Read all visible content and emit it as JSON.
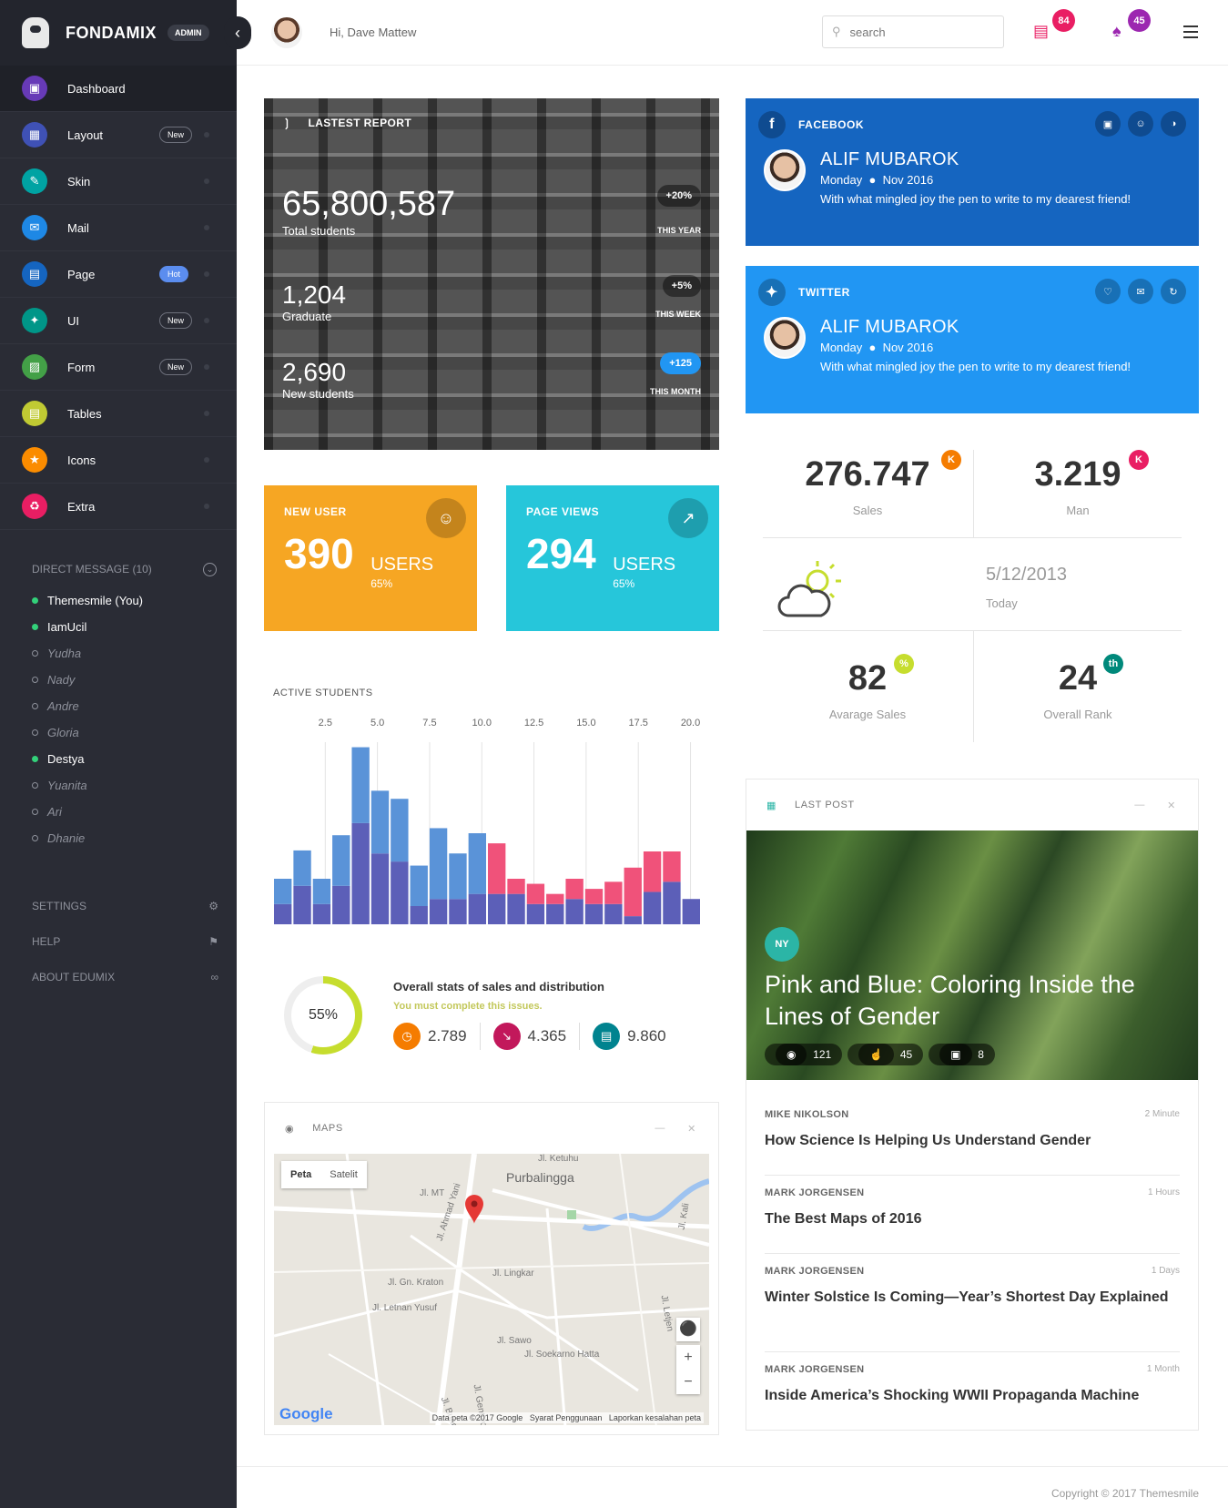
{
  "brand": {
    "name": "FONDAMIX",
    "badge": "ADMIN"
  },
  "sidebar": {
    "items": [
      {
        "label": "Dashboard",
        "color": "#673ab7",
        "active": true
      },
      {
        "label": "Layout",
        "color": "#3f51b5",
        "tag": "New"
      },
      {
        "label": "Skin",
        "color": "#00a3a3"
      },
      {
        "label": "Mail",
        "color": "#1e88e5"
      },
      {
        "label": "Page",
        "color": "#1565c0",
        "tag": "Hot"
      },
      {
        "label": "UI",
        "color": "#009688",
        "tag": "New"
      },
      {
        "label": "Form",
        "color": "#43a047",
        "tag": "New"
      },
      {
        "label": "Tables",
        "color": "#c0ca33"
      },
      {
        "label": "Icons",
        "color": "#fb8c00"
      },
      {
        "label": "Extra",
        "color": "#e91e63"
      }
    ],
    "dm_title": "DIRECT MESSAGE (10)",
    "dm": [
      {
        "name": "Themesmile (You)",
        "online": true
      },
      {
        "name": "IamUcil",
        "online": true
      },
      {
        "name": "Yudha",
        "online": false
      },
      {
        "name": "Nady",
        "online": false
      },
      {
        "name": "Andre",
        "online": false
      },
      {
        "name": "Gloria",
        "online": false
      },
      {
        "name": "Destya",
        "online": true
      },
      {
        "name": "Yuanita",
        "online": false
      },
      {
        "name": "Ari",
        "online": false
      },
      {
        "name": "Dhanie",
        "online": false
      }
    ],
    "settings": "SETTINGS",
    "help": "HELP",
    "about": "ABOUT EDUMIX"
  },
  "topbar": {
    "greeting": "Hi, Dave Mattew",
    "search_placeholder": "search",
    "docs_count": "84",
    "notif_count": "45"
  },
  "report": {
    "title": "LASTEST REPORT",
    "rows": [
      {
        "value": "65,800,587",
        "label": "Total students",
        "pill": "+20%",
        "period": "THIS YEAR"
      },
      {
        "value": "1,204",
        "label": "Graduate",
        "pill": "+5%",
        "period": "THIS WEEK"
      },
      {
        "value": "2,690",
        "label": "New students",
        "pill": "+125",
        "period": "THIS MONTH"
      }
    ]
  },
  "new_user": {
    "title": "NEW USER",
    "value": "390",
    "unit": "USERS",
    "pct": "65%",
    "color": "#f6a623"
  },
  "page_views": {
    "title": "PAGE VIEWS",
    "value": "294",
    "unit": "USERS",
    "pct": "65%",
    "color": "#26c6da"
  },
  "chart_data": {
    "type": "bar",
    "title": "ACTIVE STUDENTS",
    "x_ticks": [
      "2.5",
      "5.0",
      "7.5",
      "10.0",
      "12.5",
      "15.0",
      "17.5",
      "20.0"
    ],
    "xlim": [
      0,
      20.5
    ],
    "ylim": [
      0,
      180
    ],
    "colors": {
      "base": "#5c5fb8",
      "blue": "#5a93d8",
      "pink": "#f0527a"
    },
    "series": [
      {
        "values": [
          20,
          38,
          20,
          38,
          100,
          70,
          62,
          18,
          25,
          25,
          30,
          30,
          30,
          20,
          20,
          25,
          20,
          20,
          8,
          32,
          42,
          25
        ]
      },
      {
        "values": [
          25,
          35,
          25,
          50,
          75,
          62,
          62,
          40,
          70,
          45,
          60,
          0,
          0,
          0,
          0,
          0,
          0,
          0,
          0,
          0,
          0,
          0
        ],
        "color": "blue"
      },
      {
        "values": [
          0,
          0,
          0,
          0,
          0,
          0,
          0,
          0,
          0,
          0,
          0,
          50,
          15,
          20,
          10,
          20,
          15,
          22,
          48,
          40,
          30
        ],
        "color": "pink"
      }
    ]
  },
  "overall": {
    "donut": "55%",
    "donut_value": 55,
    "title": "Overall stats of sales and distribution",
    "sub": "You must complete this issues.",
    "metrics": [
      {
        "value": "2.789",
        "color": "#f57c00",
        "icon": "clock-icon"
      },
      {
        "value": "4.365",
        "color": "#c2185b",
        "icon": "trend-down-icon"
      },
      {
        "value": "9.860",
        "color": "#00838f",
        "icon": "chart-icon"
      }
    ]
  },
  "maps": {
    "title": "MAPS",
    "tab1": "Peta",
    "tab2": "Satelit",
    "attrib": "Data peta ©2017 Google",
    "terms": "Syarat Penggunaan",
    "report": "Laporkan kesalahan peta",
    "logo": "Google",
    "streets": [
      "Jl. Ketuhu",
      "Purbalingga",
      "Jl. MT",
      "Jl. Lingkar",
      "Jl. Gn. Kraton",
      "Jl. Letnan Yusuf",
      "Jl. Sawo",
      "Jl. Soekarno Hatta",
      "Jl. Ahmad Yani",
      "Jl. Bung Karno",
      "Jl. Gentiyo",
      "Jl. Kali",
      "Jl. Letjen"
    ]
  },
  "facebook": {
    "title": "FACEBOOK",
    "name": "ALIF MUBAROK",
    "day": "Monday",
    "date": "Nov 2016",
    "msg": "With what mingled joy the pen to write to my dearest friend!",
    "color": "#1565c0"
  },
  "twitter": {
    "title": "TWITTER",
    "name": "ALIF MUBAROK",
    "day": "Monday",
    "date": "Nov 2016",
    "msg": "With what mingled joy the pen to write to my dearest friend!",
    "color": "#2196f3"
  },
  "kpis": {
    "sales": {
      "value": "276.747",
      "label": "Sales",
      "badge": "K",
      "color": "#f57c00"
    },
    "man": {
      "value": "3.219",
      "label": "Man",
      "badge": "K",
      "color": "#e91e63"
    },
    "weather_date": "5/12/2013",
    "weather_label": "Today",
    "avg": {
      "value": "82",
      "label": "Avarage Sales",
      "badge": "%",
      "color": "#c6dd2e"
    },
    "rank": {
      "value": "24",
      "label": "Overall Rank",
      "badge": "th",
      "color": "#00897b"
    }
  },
  "last_post": {
    "title": "LAST POST",
    "tag": "NY",
    "headline": "Pink and Blue: Coloring Inside the Lines of Gender",
    "views": "121",
    "likes": "45",
    "comments": "8",
    "news": [
      {
        "author": "MIKE NIKOLSON",
        "time": "2 Minute",
        "title": "How Science Is Helping Us Understand Gender"
      },
      {
        "author": "MARK JORGENSEN",
        "time": "1 Hours",
        "title": "The Best Maps of 2016"
      },
      {
        "author": "MARK JORGENSEN",
        "time": "1 Days",
        "title": "Winter Solstice Is Coming—Year’s Shortest Day Explained"
      },
      {
        "author": "MARK JORGENSEN",
        "time": "1 Month",
        "title": "Inside America’s Shocking WWII Propaganda Machine"
      }
    ]
  },
  "footer": "Copyright © 2017 Themesmile"
}
